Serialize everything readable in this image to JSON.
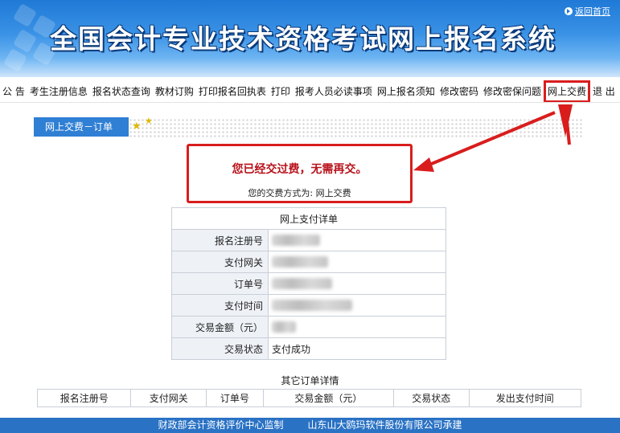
{
  "header": {
    "title": "全国会计专业技术资格考试网上报名系统",
    "back_home": "返回首页"
  },
  "nav": {
    "items": [
      "公 告",
      "考生注册信息",
      "报名状态查询",
      "教材订购",
      "打印报名回执表",
      "打印",
      "报考人员必读事项",
      "网上报名须知",
      "修改密码",
      "修改密保问题",
      "网上交费",
      "退 出"
    ],
    "highlighted_index": 10
  },
  "section": {
    "tab_label": "网上交费－订单"
  },
  "notice": {
    "main": "您已经交过费，无需再交。",
    "sub": "您的交费方式为:   网上交费"
  },
  "payment_detail": {
    "caption": "网上支付详单",
    "rows": [
      {
        "label": "报名注册号",
        "value": ""
      },
      {
        "label": "支付网关",
        "value": ""
      },
      {
        "label": "订单号",
        "value": ""
      },
      {
        "label": "支付时间",
        "value": ""
      },
      {
        "label": "交易金额（元）",
        "value": ""
      },
      {
        "label": "交易状态",
        "value": "支付成功"
      }
    ]
  },
  "other_orders": {
    "caption": "其它订单详情",
    "columns": [
      "报名注册号",
      "支付网关",
      "订单号",
      "交易金额（元）",
      "交易状态",
      "发出支付时间"
    ]
  },
  "footer": {
    "left": "财政部会计资格评价中心监制",
    "right": "山东山大鸥玛软件股份有限公司承建"
  },
  "colors": {
    "highlight_red": "#d91d1d",
    "tab_blue": "#2f7fd4",
    "footer_blue": "#2a72c4",
    "notice_red": "#b8111a"
  }
}
